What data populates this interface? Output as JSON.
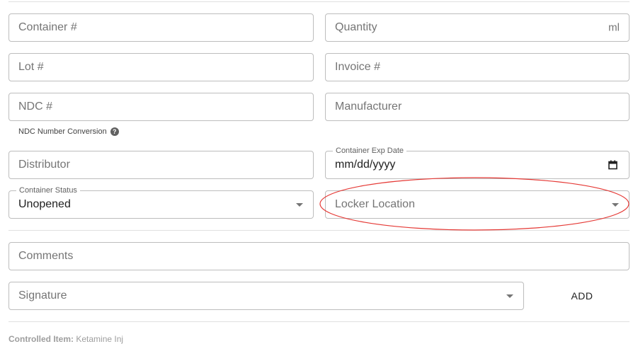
{
  "fields": {
    "container_number": {
      "placeholder": "Container #"
    },
    "quantity": {
      "placeholder": "Quantity",
      "unit": "ml"
    },
    "lot_number": {
      "placeholder": "Lot #"
    },
    "invoice_number": {
      "placeholder": "Invoice #"
    },
    "ndc_number": {
      "placeholder": "NDC #"
    },
    "manufacturer": {
      "placeholder": "Manufacturer"
    },
    "ndc_helper": {
      "label": "NDC Number Conversion",
      "icon": "help-circle-icon"
    },
    "distributor": {
      "placeholder": "Distributor"
    },
    "container_exp_date": {
      "label": "Container Exp Date",
      "value": "mm/dd/yyyy",
      "icon": "calendar-icon"
    },
    "container_status": {
      "label": "Container Status",
      "value": "Unopened"
    },
    "locker_location": {
      "placeholder": "Locker Location"
    },
    "comments": {
      "placeholder": "Comments"
    },
    "signature": {
      "placeholder": "Signature"
    }
  },
  "actions": {
    "add_label": "ADD"
  },
  "footer": {
    "label": "Controlled Item:",
    "value": "Ketamine Inj"
  },
  "annotation": {
    "type": "red-ellipse",
    "target": "Locker Location",
    "color": "#e53935"
  }
}
